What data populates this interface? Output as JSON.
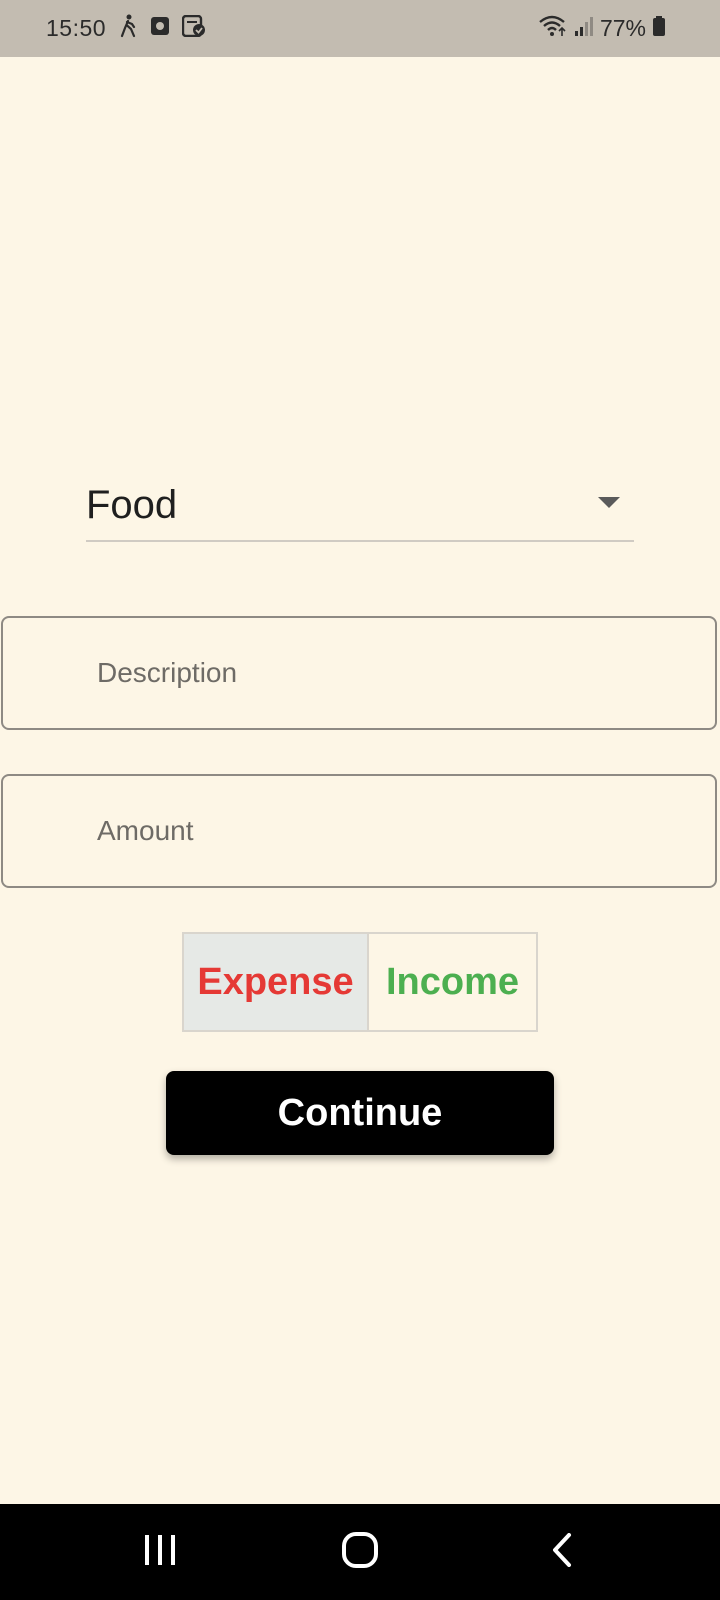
{
  "status_bar": {
    "time": "15:50",
    "battery": "77%",
    "icons": [
      "walking-icon",
      "recorder-icon",
      "task-icon",
      "wifi-icon",
      "signal-icon",
      "battery-icon"
    ]
  },
  "form": {
    "category": {
      "selected": "Food"
    },
    "description": {
      "placeholder": "Description",
      "value": ""
    },
    "amount": {
      "placeholder": "Amount",
      "value": ""
    },
    "type_toggle": {
      "expense": "Expense",
      "income": "Income",
      "selected": "Expense"
    },
    "continue_label": "Continue"
  },
  "colors": {
    "background": "#fdf6e6",
    "expense": "#e53935",
    "income": "#4caf50",
    "button": "#000000"
  },
  "nav_bar": {
    "icons": [
      "recents-icon",
      "home-icon",
      "back-icon"
    ]
  }
}
